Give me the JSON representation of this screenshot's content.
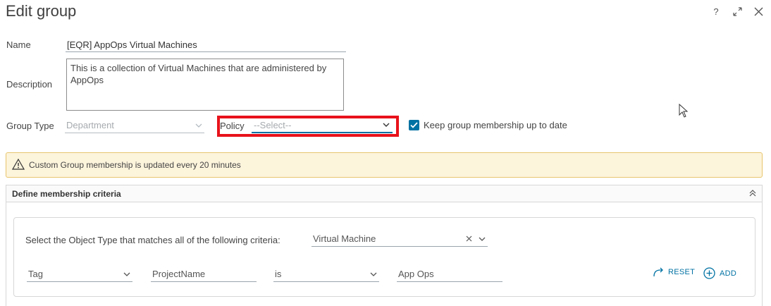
{
  "dialog": {
    "title": "Edit group",
    "help_label": "?"
  },
  "form": {
    "name_label": "Name",
    "name_value": "[EQR] AppOps Virtual Machines",
    "description_label": "Description",
    "description_value": "This is a collection of Virtual Machines that are administered by AppOps",
    "group_type_label": "Group Type",
    "group_type_value": "Department",
    "policy_label": "Policy",
    "policy_placeholder": "--Select--",
    "keep_membership_label": "Keep group membership up to date",
    "keep_membership_checked": true
  },
  "alert": {
    "message": "Custom Group membership is updated every 20 minutes"
  },
  "criteria": {
    "section_title": "Define membership criteria",
    "object_type_prompt": "Select the Object Type that matches all of the following criteria:",
    "object_type_value": "Virtual Machine",
    "rule": {
      "property": "Tag",
      "key": "ProjectName",
      "operator": "is",
      "value": "App Ops"
    },
    "reset_label": "RESET",
    "add_label": "ADD"
  },
  "colors": {
    "accent": "#0072a3",
    "highlight_box": "#e8121b",
    "alert_bg": "#fdf4dc"
  }
}
